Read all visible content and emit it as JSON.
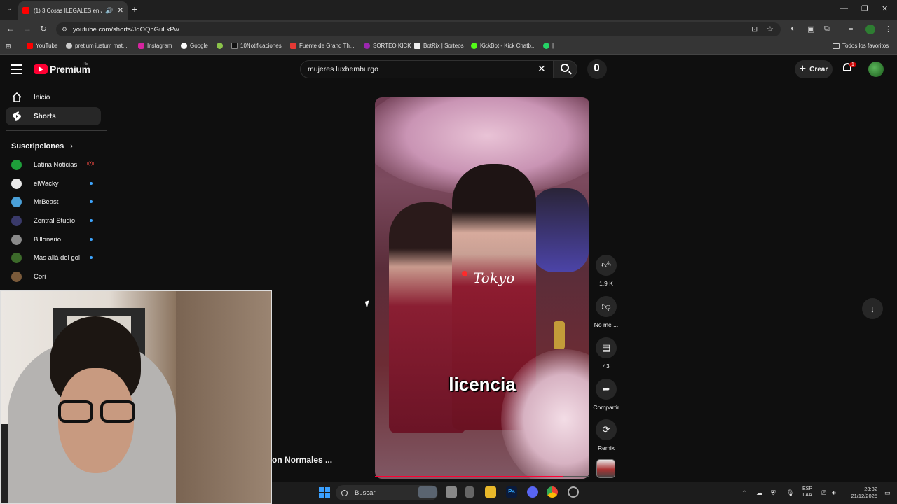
{
  "browser": {
    "tab_title": "(1) 3 Cosas ILEGALES en Jap",
    "url": "youtube.com/shorts/JdOQhGuLkPw",
    "bookmarks": [
      "YouTube",
      "pretium iustum mat...",
      "Instagram",
      "Google",
      "10Notificaciones",
      "Fuente de Grand Th...",
      "SORTEO KICK",
      "BotRix | Sorteos",
      "KickBot - Kick Chatb...",
      "|"
    ],
    "all_bookmarks_label": "Todos los favoritos"
  },
  "youtube": {
    "logo_text": "Premium",
    "country": "PE",
    "search_query": "mujeres luxbemburgo",
    "create_label": "Crear",
    "notification_count": "1"
  },
  "sidebar": {
    "items": [
      {
        "label": "Inicio"
      },
      {
        "label": "Shorts"
      }
    ],
    "subscriptions_title": "Suscripciones",
    "subscriptions": [
      {
        "name": "Latina Noticias",
        "live": true,
        "color": "#1e9e3a"
      },
      {
        "name": "elWacky",
        "color": "#e8e8e8"
      },
      {
        "name": "MrBeast",
        "color": "#4aa0d8"
      },
      {
        "name": "Zentral Studio",
        "color": "#3a3a6a"
      },
      {
        "name": "Billonario",
        "color": "#8a8a8a"
      },
      {
        "name": "Más allá del gol",
        "color": "#3c6a2a"
      },
      {
        "name": "Cori",
        "color": "#7a5a3a"
      }
    ]
  },
  "short": {
    "overlay_location": "Tokyo",
    "caption": "licencia",
    "title_partial": "on Normales ...",
    "progress": 0.88,
    "actions": {
      "likes": "1,9 K",
      "dislike_label": "No me ...",
      "comments": "43",
      "share_label": "Compartir",
      "remix_label": "Remix"
    }
  },
  "taskbar": {
    "search_label": "Buscar",
    "lang_line1": "ESP",
    "lang_line2": "LAA",
    "time": "23:32",
    "date": "21/12/2025"
  }
}
